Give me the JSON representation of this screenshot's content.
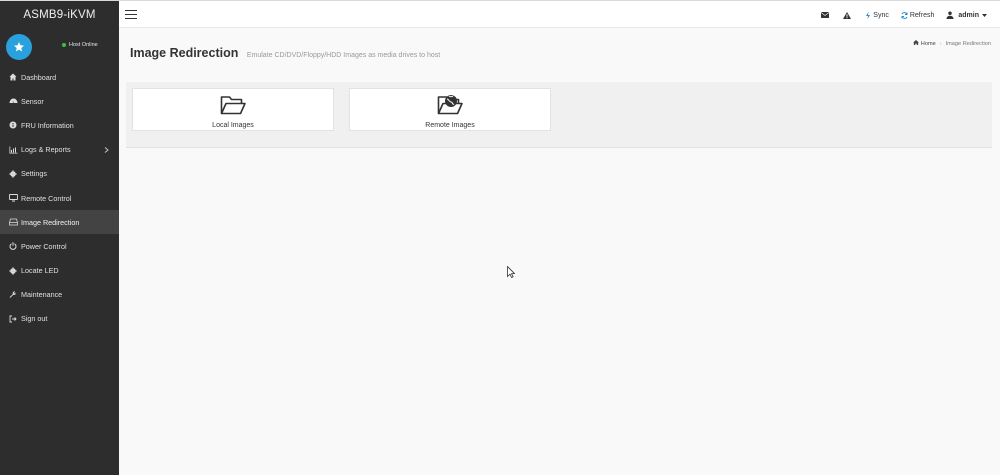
{
  "brand": "ASMB9-iKVM",
  "host_status": "Host Online",
  "menu": [
    {
      "label": "Dashboard",
      "icon": "dashboard-icon"
    },
    {
      "label": "Sensor",
      "icon": "sensor-icon"
    },
    {
      "label": "FRU Information",
      "icon": "info-icon"
    },
    {
      "label": "Logs & Reports",
      "icon": "chart-icon"
    },
    {
      "label": "Settings",
      "icon": "gear-icon"
    },
    {
      "label": "Remote Control",
      "icon": "monitor-icon"
    },
    {
      "label": "Image Redirection",
      "icon": "disk-icon"
    },
    {
      "label": "Power Control",
      "icon": "power-icon"
    },
    {
      "label": "Locate LED",
      "icon": "led-icon"
    },
    {
      "label": "Maintenance",
      "icon": "wrench-icon"
    },
    {
      "label": "Sign out",
      "icon": "sign-out-icon"
    }
  ],
  "active_menu": "Image Redirection",
  "topbar": {
    "sync": "Sync",
    "refresh": "Refresh",
    "user": "admin"
  },
  "page": {
    "title": "Image Redirection",
    "subtitle": "Emulate CD/DVD/Floppy/HDD Images as media drives to host"
  },
  "breadcrumb": {
    "home": "Home",
    "current": "Image Redirection"
  },
  "cards": [
    {
      "label": "Local Images",
      "icon": "folder-open-icon"
    },
    {
      "label": "Remote Images",
      "icon": "remote-folder-icon"
    }
  ],
  "colors": {
    "sidebar": "#2d2d2d",
    "sidebar_active": "#434343",
    "accent": "#2aa1dc",
    "online": "#3fbf3f"
  }
}
